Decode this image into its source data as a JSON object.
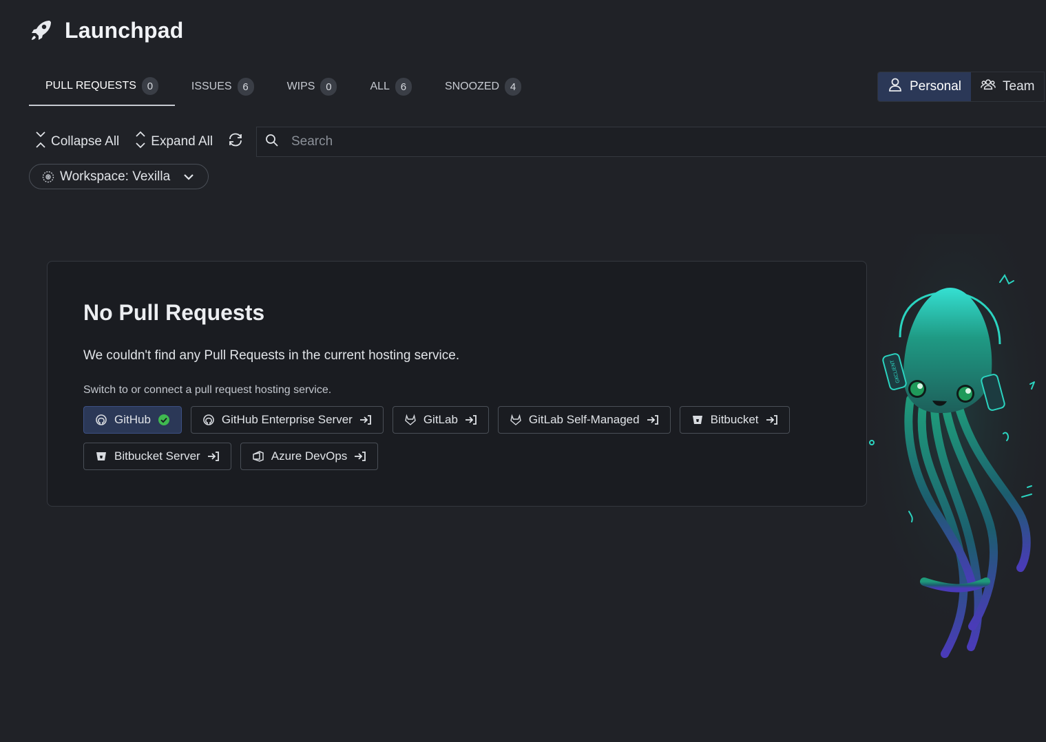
{
  "header": {
    "title": "Launchpad",
    "icon": "rocket-icon"
  },
  "tabs": [
    {
      "label": "PULL REQUESTS",
      "count": "0"
    },
    {
      "label": "ISSUES",
      "count": "6"
    },
    {
      "label": "WIPS",
      "count": "0"
    },
    {
      "label": "ALL",
      "count": "6"
    },
    {
      "label": "SNOOZED",
      "count": "4"
    }
  ],
  "view_toggle": {
    "personal": "Personal",
    "team": "Team",
    "selected": "Personal"
  },
  "toolbar": {
    "collapse_all": "Collapse All",
    "expand_all": "Expand All"
  },
  "search": {
    "placeholder": "Search",
    "value": ""
  },
  "workspace": {
    "label": "Workspace: Vexilla"
  },
  "empty_state": {
    "title": "No Pull Requests",
    "message": "We couldn't find any Pull Requests in the current hosting service.",
    "hint": "Switch to or connect a pull request hosting service."
  },
  "providers": [
    {
      "label": "GitHub",
      "icon": "github-icon",
      "connected": true
    },
    {
      "label": "GitHub Enterprise Server",
      "icon": "github-icon",
      "connected": false
    },
    {
      "label": "GitLab",
      "icon": "gitlab-icon",
      "connected": false
    },
    {
      "label": "GitLab Self-Managed",
      "icon": "gitlab-icon",
      "connected": false
    },
    {
      "label": "Bitbucket",
      "icon": "bitbucket-icon",
      "connected": false
    },
    {
      "label": "Bitbucket Server",
      "icon": "bitbucket-icon",
      "connected": false
    },
    {
      "label": "Azure DevOps",
      "icon": "azure-devops-icon",
      "connected": false
    }
  ],
  "mascot_label": "GKCLIENT",
  "colors": {
    "background": "#202227",
    "accent": "#2b3857",
    "success": "#3fb950",
    "mascot": "#2bd4c0"
  }
}
